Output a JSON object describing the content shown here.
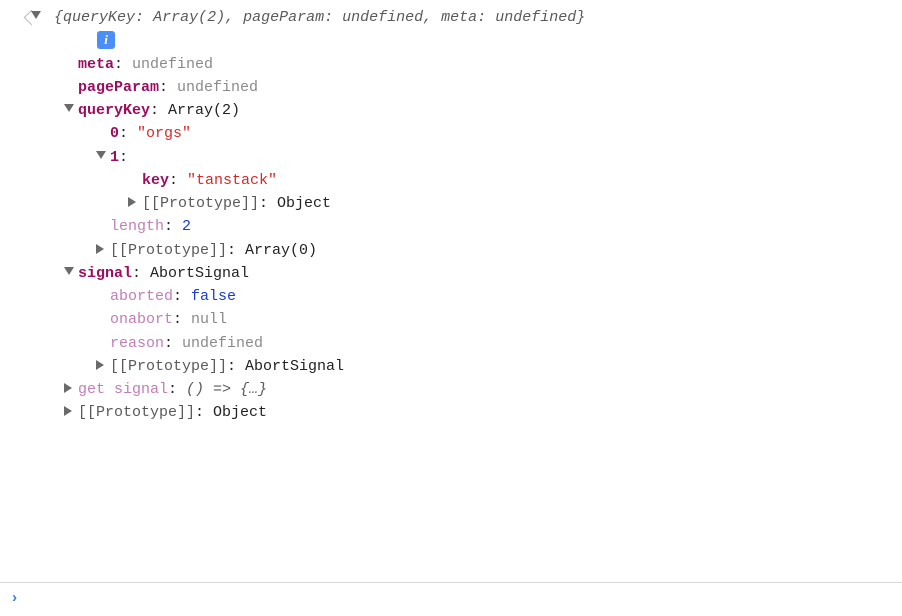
{
  "summary": {
    "open": "{",
    "k1": "queryKey",
    "v1": "Array(2)",
    "k2": "pageParam",
    "v2": "undefined",
    "k3": "meta",
    "v3": "undefined",
    "close": "}"
  },
  "infoBadge": "i",
  "tree": {
    "meta": {
      "label": "meta",
      "value": "undefined"
    },
    "pageParam": {
      "label": "pageParam",
      "value": "undefined"
    },
    "queryKey": {
      "label": "queryKey",
      "type": "Array(2)",
      "item0": {
        "index": "0",
        "value": "\"orgs\""
      },
      "item1": {
        "index": "1",
        "key": {
          "label": "key",
          "value": "\"tanstack\""
        },
        "proto": {
          "label": "[[Prototype]]",
          "value": "Object"
        }
      },
      "length": {
        "label": "length",
        "value": "2"
      },
      "proto": {
        "label": "[[Prototype]]",
        "value": "Array(0)"
      }
    },
    "signal": {
      "label": "signal",
      "type": "AbortSignal",
      "aborted": {
        "label": "aborted",
        "value": "false"
      },
      "onabort": {
        "label": "onabort",
        "value": "null"
      },
      "reason": {
        "label": "reason",
        "value": "undefined"
      },
      "proto": {
        "label": "[[Prototype]]",
        "value": "AbortSignal"
      }
    },
    "getSignal": {
      "prefix": "get ",
      "name": "signal",
      "value": "() => {…}"
    },
    "proto": {
      "label": "[[Prototype]]",
      "value": "Object"
    }
  },
  "sep": ": ",
  "comma": ", ",
  "promptCaret": "›"
}
